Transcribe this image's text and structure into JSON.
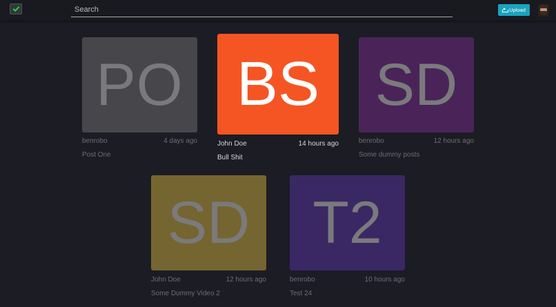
{
  "header": {
    "logo_icon": "checkmark-logo-icon",
    "search_placeholder": "Search",
    "upload_label": "Upload",
    "upload_icon": "upload-icon",
    "avatar_icon": "user-avatar"
  },
  "colors": {
    "accent": "#1aa3bd",
    "background": "#1c1c24",
    "card1": "#47474b",
    "card2": "#f55523",
    "card3": "#4a2459",
    "card4": "#756530",
    "card5": "#3a2864"
  },
  "posts": [
    {
      "initials": "PO",
      "author": "benrobo",
      "time": "4 days ago",
      "title": "Post One"
    },
    {
      "initials": "BS",
      "author": "John Doe",
      "time": "14 hours ago",
      "title": "Bull Shit"
    },
    {
      "initials": "SD",
      "author": "benrobo",
      "time": "12 hours ago",
      "title": "Some dummy posts"
    },
    {
      "initials": "SD",
      "author": "John Doe",
      "time": "12 hours ago",
      "title": "Some Dummy Video 2"
    },
    {
      "initials": "T2",
      "author": "benrobo",
      "time": "10 hours ago",
      "title": "Test 24"
    }
  ]
}
